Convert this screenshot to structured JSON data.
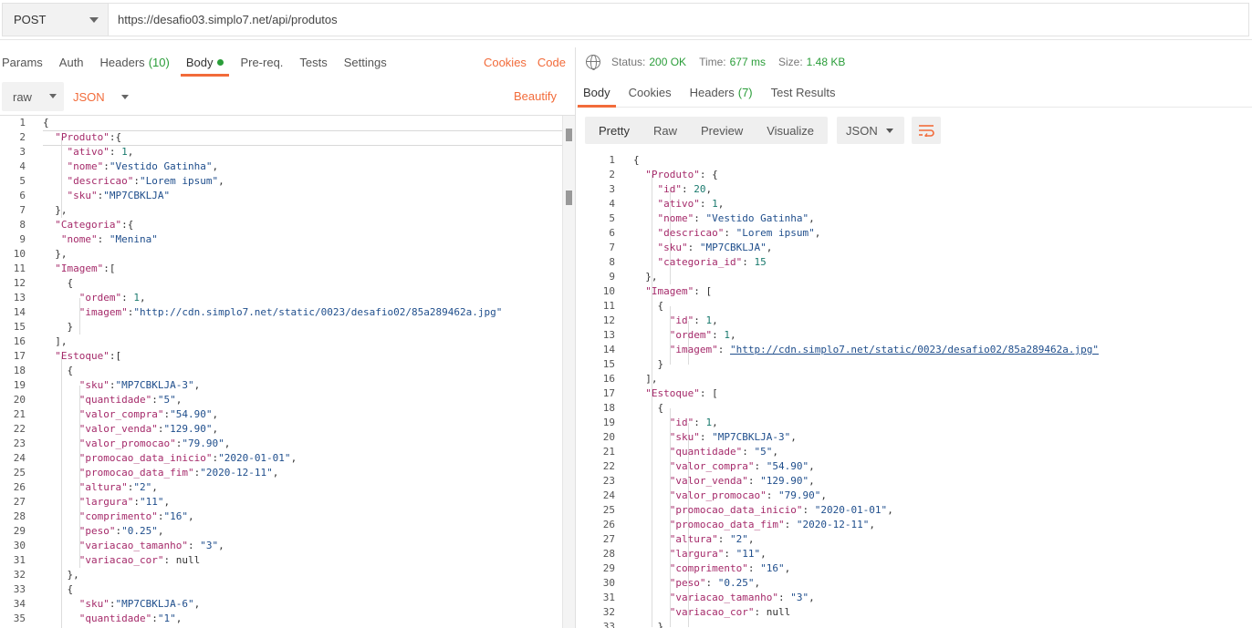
{
  "request": {
    "method": "POST",
    "url": "https://desafio03.simplo7.net/api/produtos",
    "tabs": [
      {
        "label": "Params"
      },
      {
        "label": "Auth"
      },
      {
        "label": "Headers",
        "count": "(10)"
      },
      {
        "label": "Body"
      },
      {
        "label": "Pre-req."
      },
      {
        "label": "Tests"
      },
      {
        "label": "Settings"
      }
    ],
    "cookies_label": "Cookies",
    "code_label": "Code",
    "body_mode": "raw",
    "body_format": "JSON",
    "beautify_label": "Beautify",
    "lines": [
      "{",
      "  \"Produto\":{",
      "    \"ativo\": 1,",
      "    \"nome\":\"Vestido Gatinha\",",
      "    \"descricao\":\"Lorem ipsum\",",
      "    \"sku\":\"MP7CBKLJA\"",
      "  },",
      "  \"Categoria\":{",
      "   \"nome\": \"Menina\"",
      "  },",
      "  \"Imagem\":[",
      "    {",
      "      \"ordem\": 1,",
      "      \"imagem\":\"http://cdn.simplo7.net/static/0023/desafio02/85a289462a.jpg\"",
      "    }",
      "  ],",
      "  \"Estoque\":[",
      "    {",
      "      \"sku\":\"MP7CBKLJA-3\",",
      "      \"quantidade\":\"5\",",
      "      \"valor_compra\":\"54.90\",",
      "      \"valor_venda\":\"129.90\",",
      "      \"valor_promocao\":\"79.90\",",
      "      \"promocao_data_inicio\":\"2020-01-01\",",
      "      \"promocao_data_fim\":\"2020-12-11\",",
      "      \"altura\":\"2\",",
      "      \"largura\":\"11\",",
      "      \"comprimento\":\"16\",",
      "      \"peso\":\"0.25\",",
      "      \"variacao_tamanho\": \"3\",",
      "      \"variacao_cor\": null",
      "    },",
      "    {",
      "      \"sku\":\"MP7CBKLJA-6\",",
      "      \"quantidade\":\"1\","
    ]
  },
  "response": {
    "status_label": "Status:",
    "status_value": "200 OK",
    "time_label": "Time:",
    "time_value": "677 ms",
    "size_label": "Size:",
    "size_value": "1.48 KB",
    "tabs": [
      {
        "label": "Body"
      },
      {
        "label": "Cookies"
      },
      {
        "label": "Headers",
        "count": "(7)"
      },
      {
        "label": "Test Results"
      }
    ],
    "view_modes": [
      "Pretty",
      "Raw",
      "Preview",
      "Visualize"
    ],
    "format": "JSON",
    "lines": [
      "{",
      "  \"Produto\": {",
      "    \"id\": 20,",
      "    \"ativo\": 1,",
      "    \"nome\": \"Vestido Gatinha\",",
      "    \"descricao\": \"Lorem ipsum\",",
      "    \"sku\": \"MP7CBKLJA\",",
      "    \"categoria_id\": 15",
      "  },",
      "  \"Imagem\": [",
      "    {",
      "      \"id\": 1,",
      "      \"ordem\": 1,",
      "      \"imagem\": \"http://cdn.simplo7.net/static/0023/desafio02/85a289462a.jpg\"",
      "    }",
      "  ],",
      "  \"Estoque\": [",
      "    {",
      "      \"id\": 1,",
      "      \"sku\": \"MP7CBKLJA-3\",",
      "      \"quantidade\": \"5\",",
      "      \"valor_compra\": \"54.90\",",
      "      \"valor_venda\": \"129.90\",",
      "      \"valor_promocao\": \"79.90\",",
      "      \"promocao_data_inicio\": \"2020-01-01\",",
      "      \"promocao_data_fim\": \"2020-12-11\",",
      "      \"altura\": \"2\",",
      "      \"largura\": \"11\",",
      "      \"comprimento\": \"16\",",
      "      \"peso\": \"0.25\",",
      "      \"variacao_tamanho\": \"3\",",
      "      \"variacao_cor\": null",
      "    },"
    ]
  }
}
